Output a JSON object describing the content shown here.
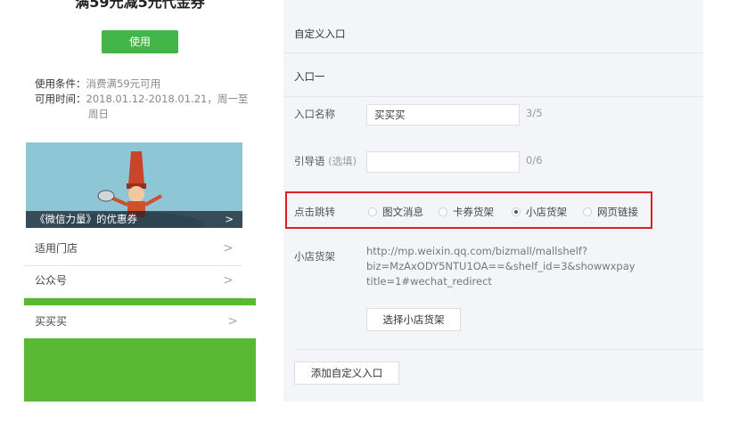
{
  "preview": {
    "card_title": "满59元减5元代金券",
    "use_button": "使用",
    "conditions_label": "使用条件：",
    "conditions_value": "消费满59元可用",
    "time_label": "可用时间：",
    "time_value": "2018.01.12-2018.01.21，周一至",
    "time_value_cont": "周日",
    "banner_caption": "《微信力量》的优惠券",
    "chevron": ">",
    "rows": [
      {
        "label": "适用门店"
      },
      {
        "label": "公众号"
      }
    ],
    "custom_entry": "买买买"
  },
  "panel": {
    "section_title": "自定义入口",
    "entry_title": "入口一",
    "name_label": "入口名称",
    "name_value": "买买买",
    "name_counter": "3/5",
    "guide_label": "引导语",
    "guide_optional": "(选填)",
    "guide_value": "",
    "guide_counter": "0/6",
    "jump_label": "点击跳转",
    "jump_options": [
      {
        "label": "图文消息",
        "selected": false
      },
      {
        "label": "卡券货架",
        "selected": false
      },
      {
        "label": "小店货架",
        "selected": true
      },
      {
        "label": "网页链接",
        "selected": false
      }
    ],
    "shelf_label": "小店货架",
    "shelf_url_line1": "http://mp.weixin.qq.com/bizmall/mallshelf?",
    "shelf_url_line2": "biz=MzAxODY5NTU1OA==&shelf_id=3&showwxpay",
    "shelf_url_line3": "title=1#wechat_redirect",
    "select_shelf_button": "选择小店货架",
    "add_entry_button": "添加自定义入口"
  }
}
